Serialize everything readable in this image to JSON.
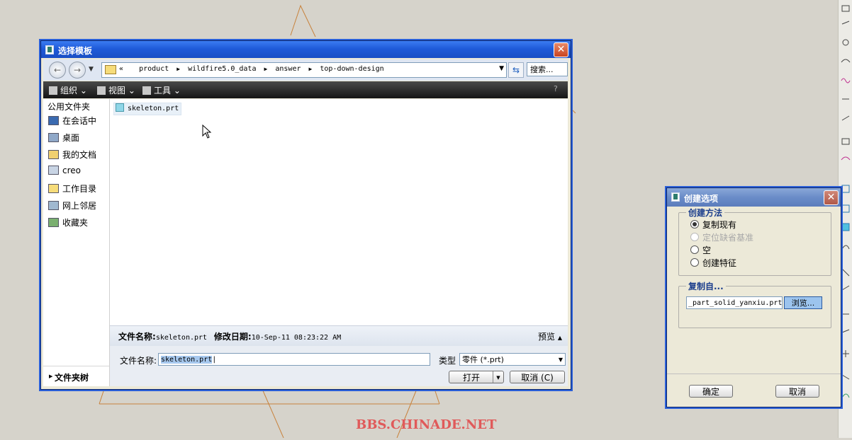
{
  "watermark": "BBS.CHINADE.NET",
  "main_dialog": {
    "title": "选择模板",
    "address_prefix": "«",
    "path": [
      "product",
      "wildfire5.0_data",
      "answer",
      "top-down-design"
    ],
    "search_placeholder": "搜索...",
    "toolbar": {
      "organize": "组织",
      "view": "视图",
      "tools": "工具"
    },
    "sidebar": {
      "header": "公用文件夹",
      "items": [
        "在会话中",
        "桌面",
        "我的文档",
        "creo",
        "工作目录",
        "网上邻居",
        "收藏夹"
      ],
      "footer": "文件夹树"
    },
    "files": [
      "skeleton.prt"
    ],
    "details": {
      "name_label": "文件名称:",
      "name_value": "skeleton.prt",
      "date_label": "修改日期:",
      "date_value": "10-Sep-11 08:23:22 AM",
      "preview": "预览"
    },
    "filename_label": "文件名称:",
    "filename_value": "skeleton.prt",
    "type_label": "类型",
    "type_value": "零件 (*.prt)",
    "open_button": "打开",
    "cancel_button": "取消 (C)"
  },
  "options_dialog": {
    "title": "创建选项",
    "method_group": "创建方法",
    "methods": [
      {
        "label": "复制现有",
        "selected": true,
        "enabled": true
      },
      {
        "label": "定位缺省基准",
        "selected": false,
        "enabled": false
      },
      {
        "label": "空",
        "selected": false,
        "enabled": true
      },
      {
        "label": "创建特征",
        "selected": false,
        "enabled": true
      }
    ],
    "copy_group": "复制自...",
    "copy_value": "_part_solid_yanxiu.prt",
    "browse_button": "浏览...",
    "ok_button": "确定",
    "cancel_button": "取消"
  },
  "colors": {
    "accent": "#1f5bd9",
    "sketch_lines": "#c8823c",
    "watermark": "#e05a5a"
  }
}
